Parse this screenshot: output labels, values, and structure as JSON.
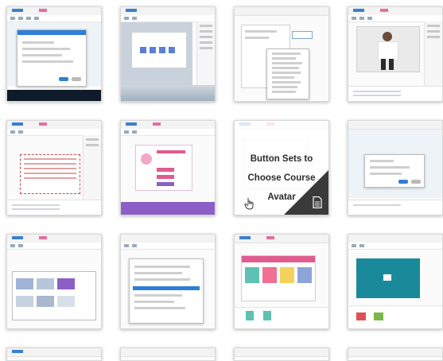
{
  "gallery": {
    "tiles": [
      {
        "kind": "dialog-form"
      },
      {
        "kind": "slide-blue-squares"
      },
      {
        "kind": "dropdown-list"
      },
      {
        "kind": "person-photo"
      },
      {
        "kind": "red-dotted-grid"
      },
      {
        "kind": "avatar-form"
      },
      {
        "kind": "hover-overlay",
        "title": "Button Sets to Choose Course Avatar",
        "icons": [
          "pointer-hand-icon",
          "document-icon"
        ]
      },
      {
        "kind": "small-dialog"
      },
      {
        "kind": "template-picker"
      },
      {
        "kind": "list-dialog"
      },
      {
        "kind": "color-cards"
      },
      {
        "kind": "teal-slide"
      },
      {
        "kind": "partial"
      },
      {
        "kind": "partial"
      },
      {
        "kind": "partial"
      },
      {
        "kind": "partial"
      }
    ]
  },
  "colors": {
    "accent_blue": "#2f7fd6",
    "ribbon_pink": "#e46fa1",
    "purple_strip": "#8c5fc6",
    "teal": "#1a8a9a",
    "overlay_corner": "#3a3a3a"
  }
}
